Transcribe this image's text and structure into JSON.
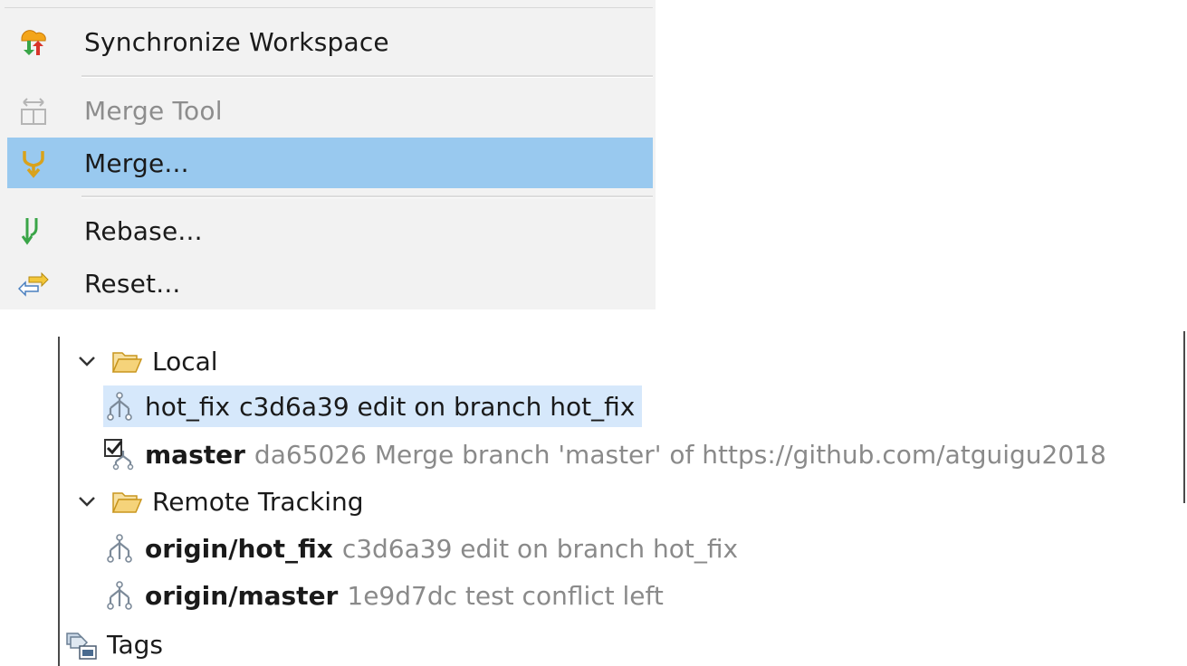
{
  "menu": {
    "items": [
      {
        "label": "Synchronize Workspace",
        "icon": "synchronize-icon",
        "enabled": true,
        "selected": false
      },
      {
        "label": "Merge Tool",
        "icon": "merge-tool-icon",
        "enabled": false,
        "selected": false
      },
      {
        "label": "Merge...",
        "icon": "merge-icon",
        "enabled": true,
        "selected": true
      },
      {
        "label": "Rebase...",
        "icon": "rebase-icon",
        "enabled": true,
        "selected": false
      },
      {
        "label": "Reset...",
        "icon": "reset-icon",
        "enabled": true,
        "selected": false
      }
    ]
  },
  "tree": {
    "local": {
      "label": "Local",
      "branches": [
        {
          "name": "hot_fix",
          "detail": "c3d6a39 edit on branch hot_fix",
          "icon": "branch-icon",
          "selected": true
        },
        {
          "name": "master",
          "detail": "da65026 Merge branch 'master' of https://github.com/atguigu2018",
          "icon": "checked-out-branch-icon",
          "selected": false
        }
      ]
    },
    "remote": {
      "label": "Remote Tracking",
      "branches": [
        {
          "name": "origin/hot_fix",
          "detail": "c3d6a39 edit on branch hot_fix",
          "icon": "branch-icon"
        },
        {
          "name": "origin/master",
          "detail": "1e9d7dc test conflict left",
          "icon": "branch-icon"
        }
      ]
    },
    "tags": {
      "label": "Tags",
      "icon": "tags-icon"
    }
  },
  "colors": {
    "menu_bg": "#f2f2f2",
    "menu_selected": "#99c9ef",
    "tree_selected": "#d6e8fb",
    "detail_text": "#8a8a8a"
  }
}
